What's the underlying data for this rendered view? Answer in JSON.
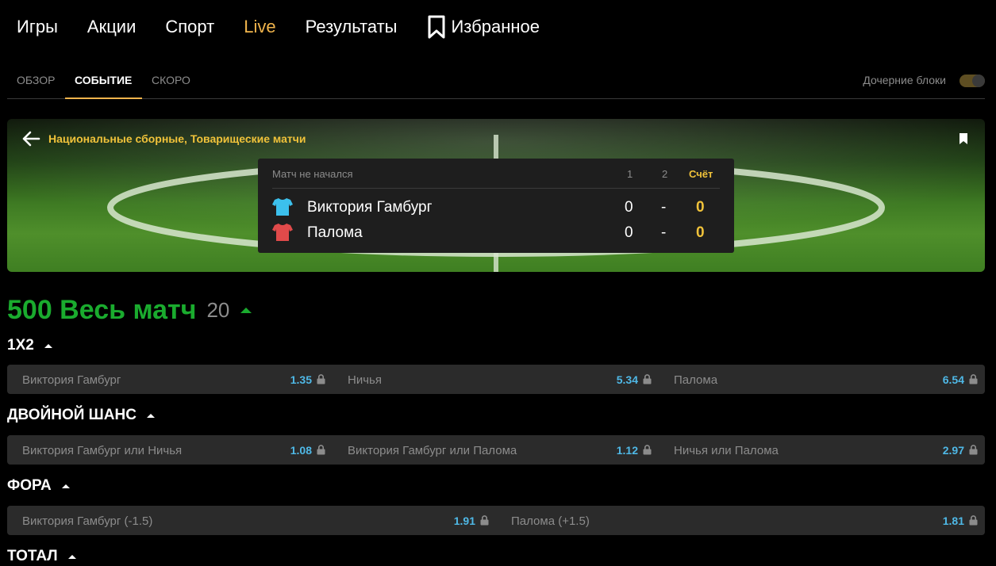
{
  "nav": {
    "items": [
      {
        "label": "Игры"
      },
      {
        "label": "Акции"
      },
      {
        "label": "Спорт"
      },
      {
        "label": "Live"
      },
      {
        "label": "Результаты"
      },
      {
        "label": "Избранное"
      }
    ]
  },
  "tabs": {
    "items": [
      {
        "label": "Обзор"
      },
      {
        "label": "Событие"
      },
      {
        "label": "Скоро"
      }
    ],
    "child_blocks_label": "Дочерние блоки"
  },
  "event": {
    "tournament": "Национальные сборные, Товарищеские матчи",
    "status": "Матч не начался",
    "col1": "1",
    "col2": "2",
    "score_label": "Счёт",
    "teams": [
      {
        "name": "Виктория Гамбург",
        "p1": "0",
        "dash": "-",
        "score": "0",
        "shirt_color": "#3cc0ec"
      },
      {
        "name": "Палома",
        "p1": "0",
        "dash": "-",
        "score": "0",
        "shirt_color": "#e04a4a"
      }
    ]
  },
  "markets": {
    "title": "500 Весь матч",
    "count": "20",
    "sections": [
      {
        "title": "1X2",
        "outcomes": [
          {
            "label": "Виктория Гамбург",
            "odd": "1.35"
          },
          {
            "label": "Ничья",
            "odd": "5.34"
          },
          {
            "label": "Палома",
            "odd": "6.54"
          }
        ]
      },
      {
        "title": "ДВОЙНОЙ ШАНС",
        "outcomes": [
          {
            "label": "Виктория Гамбург или Ничья",
            "odd": "1.08"
          },
          {
            "label": "Виктория Гамбург или Палома",
            "odd": "1.12"
          },
          {
            "label": "Ничья или Палома",
            "odd": "2.97"
          }
        ]
      },
      {
        "title": "ФОРА",
        "outcomes": [
          {
            "label": "Виктория Гамбург (-1.5)",
            "odd": "1.91"
          },
          {
            "label": "Палома (+1.5)",
            "odd": "1.81"
          }
        ]
      },
      {
        "title": "ТОТАЛ"
      }
    ]
  },
  "colors": {
    "accent": "#f0b44c",
    "odds": "#4fb8e6",
    "green": "#1aab2e",
    "score": "#f0c23a"
  }
}
